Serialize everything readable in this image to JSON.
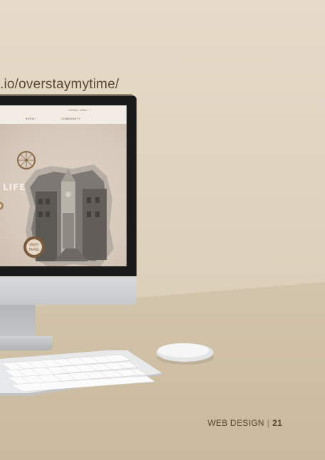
{
  "header": {
    "url_text": ".io/overstaymytime/"
  },
  "screen": {
    "login_text": "LOGIN / JOIN / ♡",
    "nav": [
      "EVENT",
      "COMMUNITY"
    ],
    "hero_word": "LIFE",
    "badge_top": "ENJOY",
    "badge_bottom": "TRAVEL"
  },
  "footer": {
    "section": "WEB DESIGN",
    "separator": "|",
    "page": "21"
  }
}
